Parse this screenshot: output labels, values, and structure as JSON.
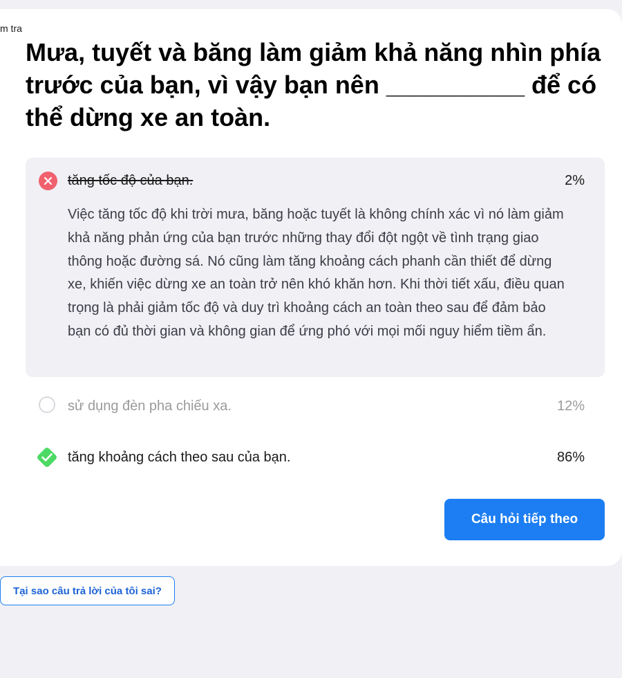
{
  "breadcrumb": "m tra",
  "question": "Mưa, tuyết và băng làm giảm khả năng nhìn phía trước của bạn, vì vậy bạn nên __________ để có thể dừng xe an toàn.",
  "options": [
    {
      "label": "tăng tốc độ của bạn.",
      "percent": "2%",
      "state": "wrong",
      "explanation": "Việc tăng tốc độ khi trời mưa, băng hoặc tuyết là không chính xác vì nó làm giảm khả năng phản ứng của bạn trước những thay đổi đột ngột về tình trạng giao thông hoặc đường sá. Nó cũng làm tăng khoảng cách phanh cần thiết để dừng xe, khiến việc dừng xe an toàn trở nên khó khăn hơn. Khi thời tiết xấu, điều quan trọng là phải giảm tốc độ và duy trì khoảng cách an toàn theo sau để đảm bảo bạn có đủ thời gian và không gian để ứng phó với mọi mối nguy hiểm tiềm ẩn."
    },
    {
      "label": "sử dụng đèn pha chiếu xa.",
      "percent": "12%",
      "state": "unselected"
    },
    {
      "label": "tăng khoảng cách theo sau của bạn.",
      "percent": "86%",
      "state": "correct"
    }
  ],
  "buttons": {
    "next": "Câu hỏi tiếp theo",
    "why_wrong": "Tại sao câu trả lời của tôi sai?"
  },
  "colors": {
    "accent": "#1c7ef2",
    "wrong": "#f0616d",
    "correct": "#4cd964",
    "panel": "#f0f0f5"
  },
  "icons": {
    "wrong": "x-circle-icon",
    "unselected": "radio-empty-icon",
    "correct": "check-diamond-icon"
  }
}
